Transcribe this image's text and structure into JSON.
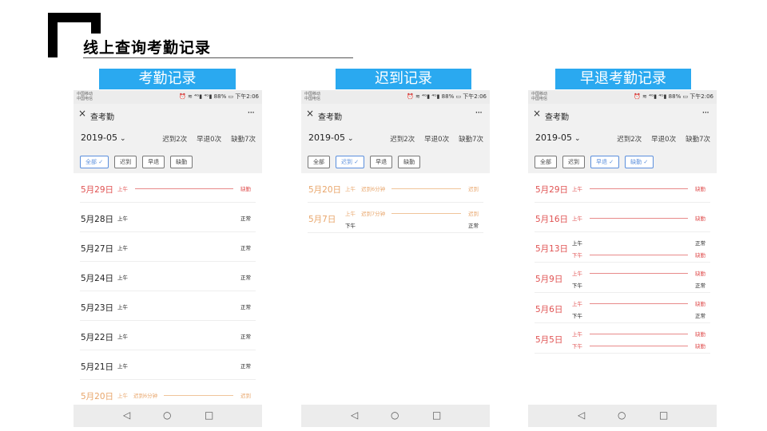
{
  "slide": {
    "title": "线上查询考勤记录"
  },
  "sections": [
    {
      "label": "考勤记录"
    },
    {
      "label": "迟到记录"
    },
    {
      "label": "早退考勤记录"
    }
  ],
  "phone": {
    "carrier_line1": "中国移动",
    "carrier_line2": "中国电信",
    "status_right": "⏰ ≋ ⁴ᴳ▮ ⁴ᴳ▮ 88% ▭ 下午2:06",
    "app_title": "查考勤",
    "close_icon": "×",
    "more_icon": "···",
    "month": "2019-05",
    "month_chevron": "⌄",
    "late_count": "迟到2次",
    "early_count": "早退0次",
    "absent_count": "缺勤7次",
    "nav_back": "◁",
    "nav_home": "○",
    "nav_recent": "□"
  },
  "screens": [
    {
      "chips": [
        {
          "label": "全部 ✓",
          "active": true
        },
        {
          "label": "迟到",
          "active": false
        },
        {
          "label": "早退",
          "active": false
        },
        {
          "label": "缺勤",
          "active": false
        }
      ],
      "rows": [
        {
          "date": "5月29日",
          "kind": "absent",
          "segments": [
            {
              "period": "上午",
              "status": "缺勤",
              "kind": "absent",
              "line": true
            }
          ]
        },
        {
          "date": "5月28日",
          "kind": "normal",
          "segments": [
            {
              "period": "上午",
              "status": "正常",
              "kind": "normal",
              "line": false
            }
          ]
        },
        {
          "date": "5月27日",
          "kind": "normal",
          "segments": [
            {
              "period": "上午",
              "status": "正常",
              "kind": "normal",
              "line": false
            }
          ]
        },
        {
          "date": "5月24日",
          "kind": "normal",
          "segments": [
            {
              "period": "上午",
              "status": "正常",
              "kind": "normal",
              "line": false
            }
          ]
        },
        {
          "date": "5月23日",
          "kind": "normal",
          "segments": [
            {
              "period": "上午",
              "status": "正常",
              "kind": "normal",
              "line": false
            }
          ]
        },
        {
          "date": "5月22日",
          "kind": "normal",
          "segments": [
            {
              "period": "上午",
              "status": "正常",
              "kind": "normal",
              "line": false
            }
          ]
        },
        {
          "date": "5月21日",
          "kind": "normal",
          "segments": [
            {
              "period": "上午",
              "status": "正常",
              "kind": "normal",
              "line": false
            }
          ]
        },
        {
          "date": "5月20日",
          "kind": "late",
          "segments": [
            {
              "period": "上午",
              "status": "迟到",
              "kind": "late",
              "line": true,
              "late_text": "迟到6分钟"
            }
          ]
        }
      ]
    },
    {
      "chips": [
        {
          "label": "全部",
          "active": false
        },
        {
          "label": "迟到 ✓",
          "active": true
        },
        {
          "label": "早退",
          "active": false
        },
        {
          "label": "缺勤",
          "active": false
        }
      ],
      "rows": [
        {
          "date": "5月20日",
          "kind": "late",
          "segments": [
            {
              "period": "上午",
              "status": "迟到",
              "kind": "late",
              "line": true,
              "late_text": "迟到6分钟"
            }
          ]
        },
        {
          "date": "5月7日",
          "kind": "late",
          "segments": [
            {
              "period": "上午",
              "status": "迟到",
              "kind": "late",
              "line": true,
              "late_text": "迟到7分钟"
            },
            {
              "period": "下午",
              "status": "正常",
              "kind": "normal",
              "line": false
            }
          ]
        }
      ]
    },
    {
      "chips": [
        {
          "label": "全部",
          "active": false
        },
        {
          "label": "迟到",
          "active": false
        },
        {
          "label": "早退 ✓",
          "active": true
        },
        {
          "label": "缺勤 ✓",
          "active": true
        }
      ],
      "rows": [
        {
          "date": "5月29日",
          "kind": "absent",
          "segments": [
            {
              "period": "上午",
              "status": "缺勤",
              "kind": "absent",
              "line": true
            }
          ]
        },
        {
          "date": "5月16日",
          "kind": "absent",
          "segments": [
            {
              "period": "上午",
              "status": "缺勤",
              "kind": "absent",
              "line": true
            }
          ]
        },
        {
          "date": "5月13日",
          "kind": "absent",
          "segments": [
            {
              "period": "上午",
              "status": "正常",
              "kind": "normal",
              "line": false
            },
            {
              "period": "下午",
              "status": "缺勤",
              "kind": "absent",
              "line": true
            }
          ]
        },
        {
          "date": "5月9日",
          "kind": "absent",
          "segments": [
            {
              "period": "上午",
              "status": "缺勤",
              "kind": "absent",
              "line": true
            },
            {
              "period": "下午",
              "status": "正常",
              "kind": "normal",
              "line": false
            }
          ]
        },
        {
          "date": "5月6日",
          "kind": "absent",
          "segments": [
            {
              "period": "上午",
              "status": "缺勤",
              "kind": "absent",
              "line": true
            },
            {
              "period": "下午",
              "status": "正常",
              "kind": "normal",
              "line": false
            }
          ]
        },
        {
          "date": "5月5日",
          "kind": "absent",
          "segments": [
            {
              "period": "上午",
              "status": "缺勤",
              "kind": "absent",
              "line": true
            },
            {
              "period": "下午",
              "status": "缺勤",
              "kind": "absent",
              "line": true
            }
          ]
        }
      ]
    }
  ]
}
